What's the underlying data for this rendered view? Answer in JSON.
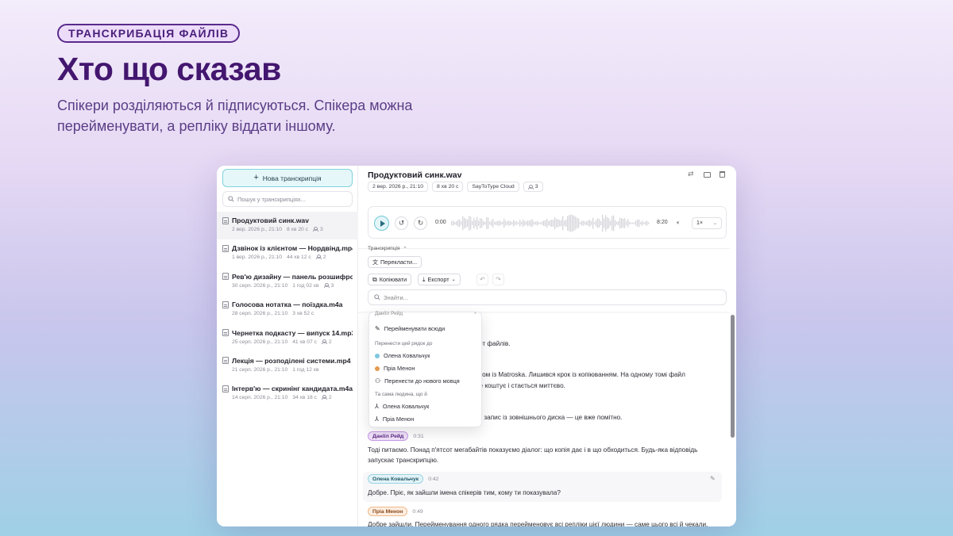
{
  "hero": {
    "pill": "ТРАНСКРИБАЦІЯ ФАЙЛІВ",
    "title": "Хто що сказав",
    "subtitle": "Спікери розділяються й підписуються. Спікера можна перейменувати, а репліку віддати іншому."
  },
  "sidebar": {
    "new_button": "Нова транскрипція",
    "search_placeholder": "Пошук у транскрипціях...",
    "files": [
      {
        "name": "Продуктовий синк.wav",
        "date": "2 вер. 2026 р., 21:10",
        "duration": "8 хв 20 с",
        "speakers": "3"
      },
      {
        "name": "Дзвінок із клієнтом — Нордвінд.mp4",
        "date": "1 вер. 2026 р., 21:10",
        "duration": "44 хв 12 с",
        "speakers": "2"
      },
      {
        "name": "Рев'ю дизайну — панель розшифровки",
        "date": "30 серп. 2026 р., 21:10",
        "duration": "1 год 02 хв",
        "speakers": "3"
      },
      {
        "name": "Голосова нотатка — поїздка.m4a",
        "date": "28 серп. 2026 р., 21:10",
        "duration": "3 хв 52 с",
        "speakers": ""
      },
      {
        "name": "Чернетка подкасту — випуск 14.mp3",
        "date": "25 серп. 2026 р., 21:10",
        "duration": "41 хв 07 с",
        "speakers": "2"
      },
      {
        "name": "Лекція — розподілені системи.mp4",
        "date": "21 серп. 2026 р., 21:10",
        "duration": "1 год 12 хв",
        "speakers": ""
      },
      {
        "name": "Інтерв'ю — скринінг кандидата.m4a",
        "date": "14 серп. 2026 р., 21:10",
        "duration": "34 хв 18 с",
        "speakers": "2"
      }
    ]
  },
  "doc": {
    "title": "Продуктовий синк.wav",
    "chips": [
      "2 вер. 2026 р., 21:10",
      "8 хв 20 с",
      "SayToType Cloud",
      "3"
    ]
  },
  "player": {
    "current": "0:00",
    "total": "8:20",
    "speed": "1×"
  },
  "toolbar": {
    "section": "Транскрипція",
    "translate": "Перекласти...",
    "copy": "Копіювати",
    "export": "Експорт",
    "find_placeholder": "Знайти..."
  },
  "menu": {
    "header": "Даніїл Рейд",
    "rename_all": "Перейменувати всюди",
    "move_heading": "Перенести цей рядок до",
    "move_options": [
      "Олена Ковальчук",
      "Пріа Менон"
    ],
    "move_new": "Перенести до нового мовця",
    "same_heading": "Та сама людина, що й",
    "same_options": [
      "Олена Ковальчук",
      "Пріа Менон"
    ]
  },
  "transcript": {
    "partials": [
      "порт файлів.",
      "азом із Matroska. Лишився крок із копіюванням. На одному томі файл",
      "не коштує і стається миттєво.",
      "ий запис із зовнішнього диска — це вже помітно."
    ],
    "segments": [
      {
        "speaker": "Даніїл Рейд",
        "time": "0:31",
        "text": "Тоді питаємо. Понад п'ятсот мегабайтів показуємо діалог: що копія дає і в що обходиться. Будь-яка відповідь запускає транскрипцію."
      },
      {
        "speaker": "Олена Ковальчук",
        "time": "0:42",
        "text": "Добре. Пріє, як зайшли імена спікерів тим, кому ти показувала?"
      },
      {
        "speaker": "Пріа Менон",
        "time": "0:49",
        "text": "Добре зайшли. Перейменування одного рядка перейменовує всі репліки цієї людини — саме цього всі й чекали."
      }
    ]
  },
  "colors": {
    "accent_teal": "#7fd3de",
    "purple_speaker": "#c79ae6",
    "blue_speaker": "#9ad3e2",
    "orange_speaker": "#f0b98a",
    "dot_blue": "#7dc8e0",
    "dot_orange": "#e59a4f"
  }
}
